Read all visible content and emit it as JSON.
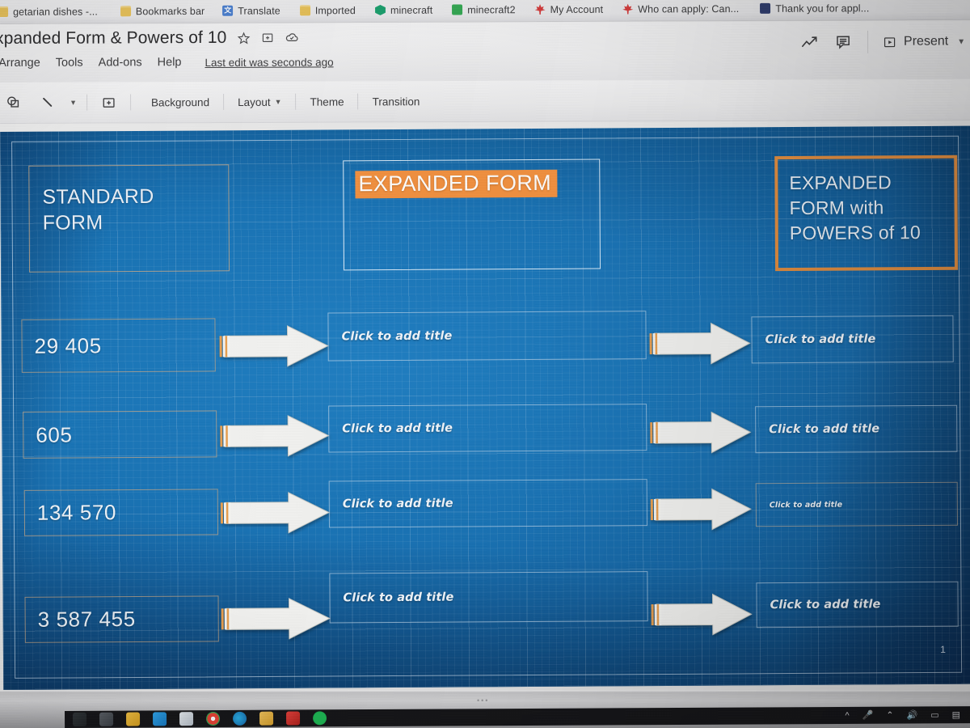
{
  "browser": {
    "bookmarks": [
      {
        "label": "getarian dishes -...",
        "icon": "folder-icon"
      },
      {
        "label": "Bookmarks bar",
        "icon": "folder-icon"
      },
      {
        "label": "Translate",
        "icon": "translate-icon"
      },
      {
        "label": "Imported",
        "icon": "folder-icon"
      },
      {
        "label": "minecraft",
        "icon": "hexagon-icon"
      },
      {
        "label": "minecraft2",
        "icon": "gift-icon"
      },
      {
        "label": "My Account",
        "icon": "maple-leaf-icon"
      },
      {
        "label": "Who can apply: Can...",
        "icon": "maple-leaf-icon"
      },
      {
        "label": "Thank you for appl...",
        "icon": "book-icon"
      }
    ]
  },
  "app": {
    "doc_title": "xpanded Form & Powers of 10",
    "title_icons": [
      "star-icon",
      "move-to-folder-icon",
      "cloud-saved-icon"
    ],
    "menus": [
      "Arrange",
      "Tools",
      "Add-ons",
      "Help"
    ],
    "last_edit": "Last edit was seconds ago",
    "right_icons": [
      "trendline-icon",
      "comment-icon"
    ],
    "present_label": "Present",
    "toolbar": {
      "items": [
        "Background",
        "Layout",
        "Theme",
        "Transition"
      ],
      "icons": [
        "shape-icon",
        "line-icon",
        "line-dropdown-caret-icon",
        "add-image-icon"
      ]
    }
  },
  "slide": {
    "slide_number": "1",
    "headers": {
      "standard": "STANDARD\nFORM",
      "standard_l1": "STANDARD",
      "standard_l2": "FORM",
      "expanded": "EXPANDED FORM",
      "powers_l1": "EXPANDED",
      "powers_l2": "FORM with",
      "powers_l3": "POWERS of 10"
    },
    "placeholder_text": "Click to add title",
    "rows": [
      {
        "number": "29 405",
        "middle": "Click to add title",
        "right": "Click to add title",
        "right_size": "normal"
      },
      {
        "number": "605",
        "middle": "Click to add title",
        "right": "Click to add title",
        "right_size": "normal"
      },
      {
        "number": "134 570",
        "middle": "Click to add title",
        "right": "Click to add title",
        "right_size": "small"
      },
      {
        "number": "3 587 455",
        "middle": "Click to add title",
        "right": "Click to add title",
        "right_size": "normal"
      }
    ]
  },
  "colors": {
    "slide_blue": "#1873b6",
    "accent_orange": "#f3913f",
    "border_orange": "#e08c3f",
    "text_white": "#eef3f8"
  },
  "taskbar": {
    "tray_icons": [
      "chevron-up-icon",
      "microphone-icon",
      "wifi-icon",
      "volume-icon",
      "battery-icon",
      "notifications-icon"
    ],
    "apps": [
      "start-icon",
      "search-icon",
      "explorer-icon",
      "store-icon",
      "files-icon",
      "chrome-icon",
      "edge-icon",
      "folder-icon",
      "acrobat-icon",
      "spotify-icon"
    ]
  }
}
